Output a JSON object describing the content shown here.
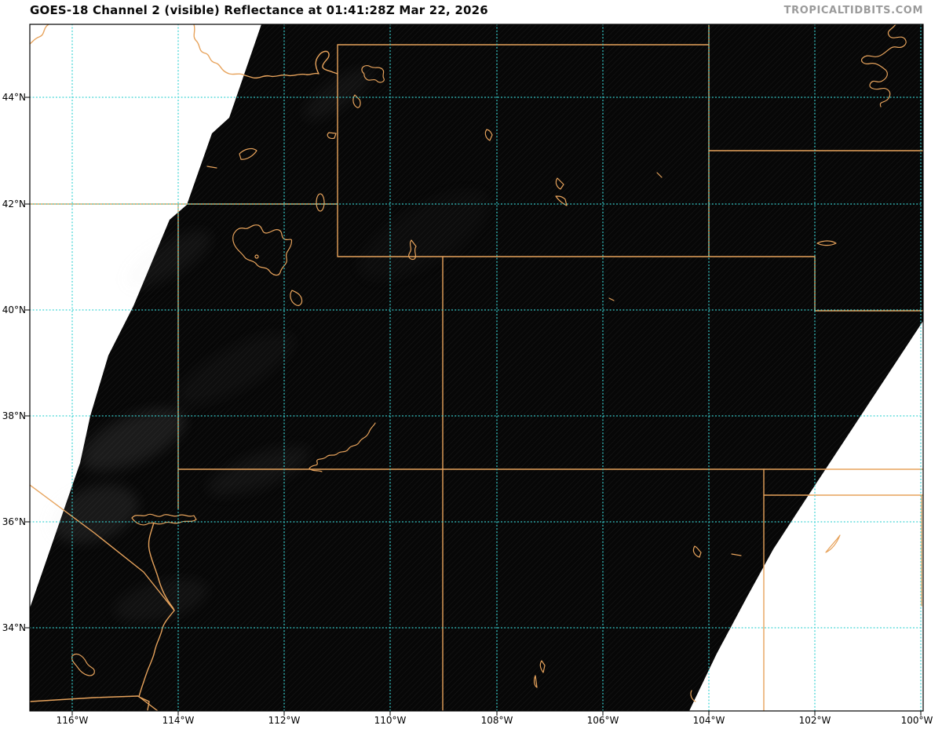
{
  "header": {
    "title": "GOES-18 Channel 2 (visible) Reflectance at 01:41:28Z Mar 22, 2026",
    "watermark": "TROPICALTIDBITS.COM"
  },
  "axes": {
    "lat_labels": [
      "44°N",
      "42°N",
      "40°N",
      "38°N",
      "36°N",
      "34°N"
    ],
    "lon_labels": [
      "116°W",
      "114°W",
      "112°W",
      "110°W",
      "108°W",
      "106°W",
      "104°W",
      "102°W",
      "100°W"
    ]
  },
  "colors": {
    "orange": "#e7a35c",
    "cyan": "#38d3d3",
    "swath": "#070707",
    "frame": "#000000",
    "title": "#0a0a0a",
    "watermark": "#9b9b9b",
    "bg": "#ffffff"
  }
}
